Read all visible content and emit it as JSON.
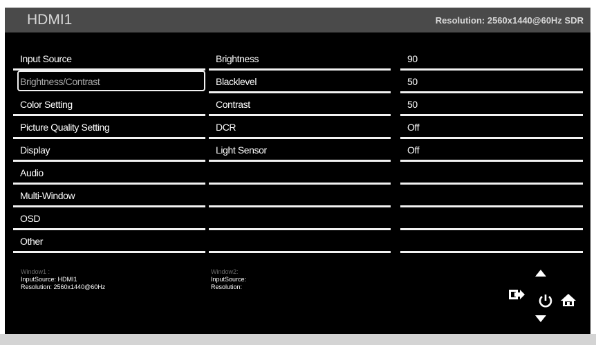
{
  "header": {
    "title": "HDMI1",
    "resolution": "Resolution: 2560x1440@60Hz SDR"
  },
  "menu": [
    {
      "label": "Input Source"
    },
    {
      "label": "Brightness/Contrast",
      "selected": true
    },
    {
      "label": "Color Setting"
    },
    {
      "label": "Picture Quality Setting"
    },
    {
      "label": "Display"
    },
    {
      "label": "Audio"
    },
    {
      "label": "Multi-Window"
    },
    {
      "label": "OSD"
    },
    {
      "label": "Other"
    }
  ],
  "settings": [
    {
      "label": "Brightness",
      "value": "90"
    },
    {
      "label": "Blacklevel",
      "value": "50"
    },
    {
      "label": "Contrast",
      "value": "50"
    },
    {
      "label": "DCR",
      "value": "Off"
    },
    {
      "label": "Light Sensor",
      "value": "Off"
    },
    {
      "label": "",
      "value": ""
    },
    {
      "label": "",
      "value": ""
    },
    {
      "label": "",
      "value": ""
    },
    {
      "label": "",
      "value": ""
    }
  ],
  "footer": {
    "window1": {
      "title": "Window1 :",
      "source": "InputSource: HDMI1",
      "resolution": "Resolution: 2560x1440@60Hz"
    },
    "window2": {
      "title": "Window2:",
      "source": "InputSource:",
      "resolution": "Resolution:"
    }
  },
  "nav_icons": [
    "up-arrow-icon",
    "exit-icon",
    "power-icon",
    "home-icon",
    "down-arrow-icon"
  ],
  "colors": {
    "background": "#000000",
    "header": "#4a4a4a",
    "text": "#ffffff",
    "selected_text": "#a9a9a9"
  }
}
